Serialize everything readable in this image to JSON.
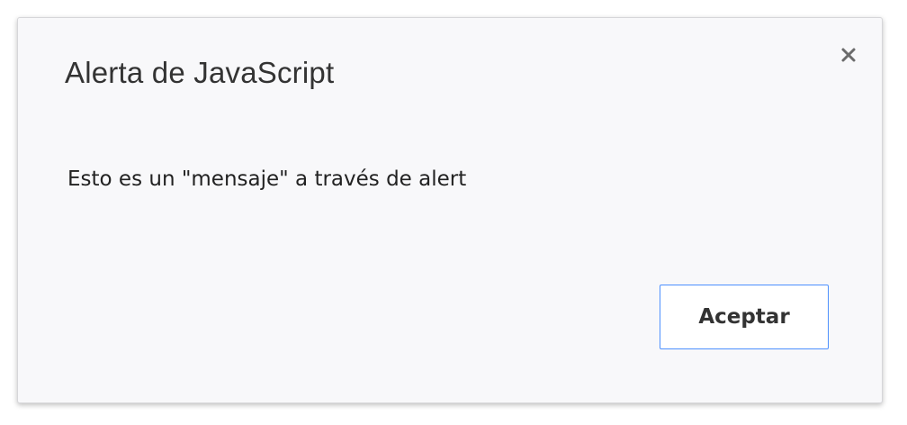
{
  "dialog": {
    "title": "Alerta de JavaScript",
    "close_icon": "close-icon",
    "message": "Esto es un \"mensaje\" a través de alert",
    "accept_label": "Aceptar"
  },
  "colors": {
    "dialog_background": "#f8f8fa",
    "button_border": "#4d90fe",
    "text": "#222222"
  }
}
